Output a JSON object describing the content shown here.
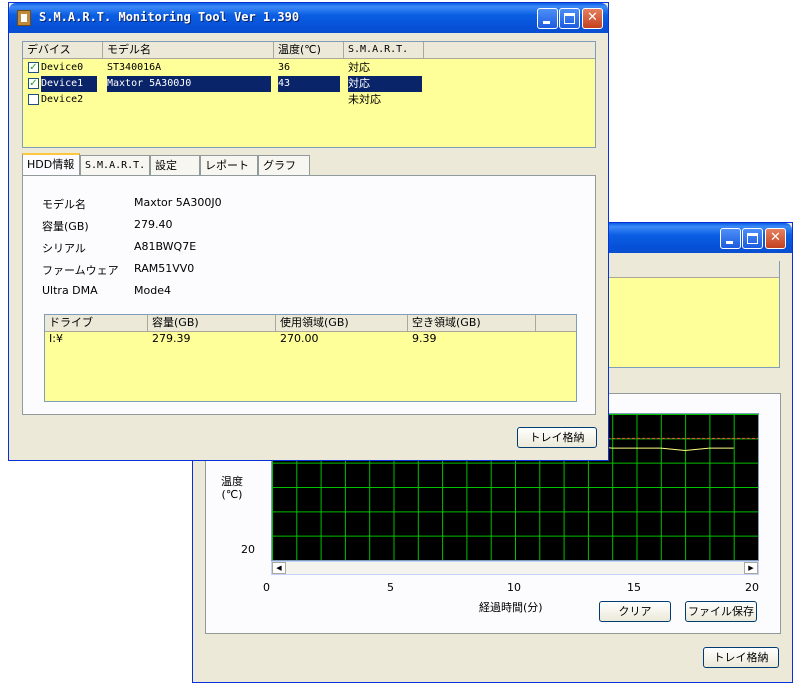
{
  "main_window": {
    "title": "S.M.A.R.T. Monitoring Tool  Ver 1.390",
    "device_list": {
      "columns": [
        "デバイス",
        "モデル名",
        "温度(℃)",
        "S.M.A.R.T."
      ],
      "rows": [
        {
          "device": "Device0",
          "model": "ST340016A",
          "temp": "36",
          "smart": "対応",
          "checked": true,
          "selected": false
        },
        {
          "device": "Device1",
          "model": "Maxtor 5A300J0",
          "temp": "43",
          "smart": "対応",
          "checked": true,
          "selected": true
        },
        {
          "device": "Device2",
          "model": "",
          "temp": "",
          "smart": "未対応",
          "checked": false,
          "selected": false
        }
      ]
    },
    "tabs": [
      "HDD情報",
      "S.M.A.R.T.",
      "設定",
      "レポート",
      "グラフ"
    ],
    "active_tab": "HDD情報",
    "hdd_info": {
      "labels": [
        "モデル名",
        "容量(GB)",
        "シリアル",
        "ファームウェア",
        "Ultra DMA"
      ],
      "values": [
        "Maxtor 5A300J0",
        "279.40",
        "A81BWQ7E",
        "RAM51VV0",
        "Mode4"
      ]
    },
    "drive_table": {
      "columns": [
        "ドライブ",
        "容量(GB)",
        "使用領域(GB)",
        "空き領域(GB)"
      ],
      "rows": [
        {
          "drive": "I:¥",
          "capacity": "279.39",
          "used": "270.00",
          "free": "9.39"
        }
      ]
    },
    "tray_button": "トレイ格納"
  },
  "graph_window": {
    "y_label": "温度\n(℃)",
    "y_tick": "20",
    "x_ticks": [
      "0",
      "5",
      "10",
      "15",
      "20"
    ],
    "x_label": "経過時間(分)",
    "clear_button": "クリア",
    "save_button": "ファイル保存",
    "tray_button": "トレイ格納"
  },
  "colors": {
    "list_bg": "#ffff99",
    "grid": "#00c000",
    "threshold_line": "#ff4040",
    "temp_line": "#ffff80",
    "selection": "#0a246a"
  },
  "chart_data": {
    "type": "line",
    "xlabel": "経過時間(分)",
    "ylabel": "温度(℃)",
    "xlim": [
      0,
      20
    ],
    "series": [
      {
        "x": [
          0,
          1,
          2,
          3,
          4,
          5,
          6,
          7,
          8,
          9,
          10,
          11,
          12,
          13,
          14,
          15,
          16,
          17,
          18,
          19
        ],
        "values": [
          43,
          43,
          42,
          43,
          43,
          43,
          43,
          43,
          43,
          43.5,
          43,
          43.5,
          43,
          43.5,
          43,
          43,
          43,
          42.5,
          43,
          43
        ]
      }
    ],
    "threshold": 45
  }
}
